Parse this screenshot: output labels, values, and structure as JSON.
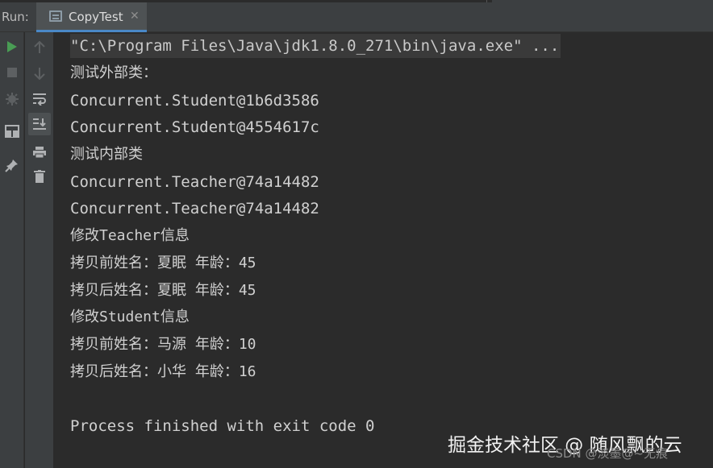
{
  "header": {
    "run_label": "Run:",
    "tab_title": "CopyTest",
    "tab_close": "✕"
  },
  "toolbar": {
    "left": [
      "run-icon",
      "stop-icon",
      "debug-bug-icon",
      "layout-icon",
      "pin-icon"
    ],
    "right": [
      "arrow-up-icon",
      "arrow-down-icon",
      "soft-wrap-icon",
      "scroll-to-end-icon",
      "print-icon",
      "trash-icon"
    ]
  },
  "console": {
    "lines": [
      "\"C:\\Program Files\\Java\\jdk1.8.0_271\\bin\\java.exe\" ...",
      "测试外部类：",
      "Concurrent.Student@1b6d3586",
      "Concurrent.Student@4554617c",
      "测试内部类",
      "Concurrent.Teacher@74a14482",
      "Concurrent.Teacher@74a14482",
      "修改Teacher信息",
      "拷贝前姓名：夏眠 年龄：45",
      "拷贝后姓名：夏眠 年龄：45",
      "修改Student信息",
      "拷贝前姓名：马源 年龄：10",
      "拷贝后姓名：小华 年龄：16",
      "Process finished with exit code 0"
    ]
  },
  "watermark": {
    "main": "掘金技术社区 @ 随风飘的云",
    "sub": "CSDN @淡墨@~无痕"
  },
  "colors": {
    "background": "#2b2b2b",
    "toolwindow": "#3c3f41",
    "console_text": "#d0d0d0",
    "tab_underline": "#4a88c7",
    "run_green": "#499c54"
  }
}
